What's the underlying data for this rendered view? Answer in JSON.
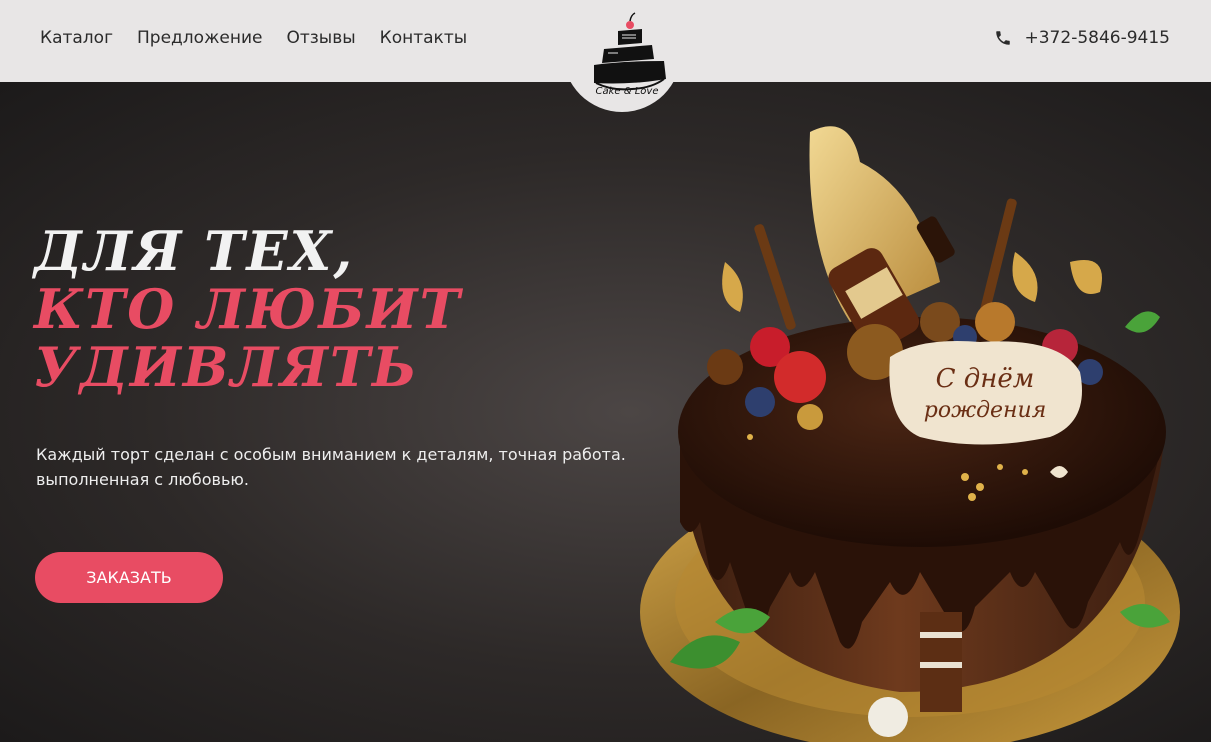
{
  "header": {
    "nav": [
      {
        "label": "Каталог"
      },
      {
        "label": "Предложение"
      },
      {
        "label": "Отзывы"
      },
      {
        "label": "Контакты"
      }
    ],
    "logo": {
      "text": "Cake & Love",
      "icon": "cake-logo-icon"
    },
    "phone": {
      "number": "+372-5846-9415",
      "icon": "phone-icon"
    }
  },
  "hero": {
    "headline": {
      "line1": "Для тех,",
      "line2": "кто любит",
      "line3": "удивлять"
    },
    "description": {
      "line1": "Каждый торт сделан с особым вниманием к деталям, точная работа.",
      "line2": "выполненная с любовью."
    },
    "cta_label": "ЗАКАЗАТЬ",
    "image": {
      "plaque_text_1": "С днём",
      "plaque_text_2": "рождения"
    }
  },
  "colors": {
    "accent": "#e84c63",
    "header_bg": "#e8e6e6",
    "hero_bg": "#2d2928",
    "text_light": "#f2f2f2"
  }
}
